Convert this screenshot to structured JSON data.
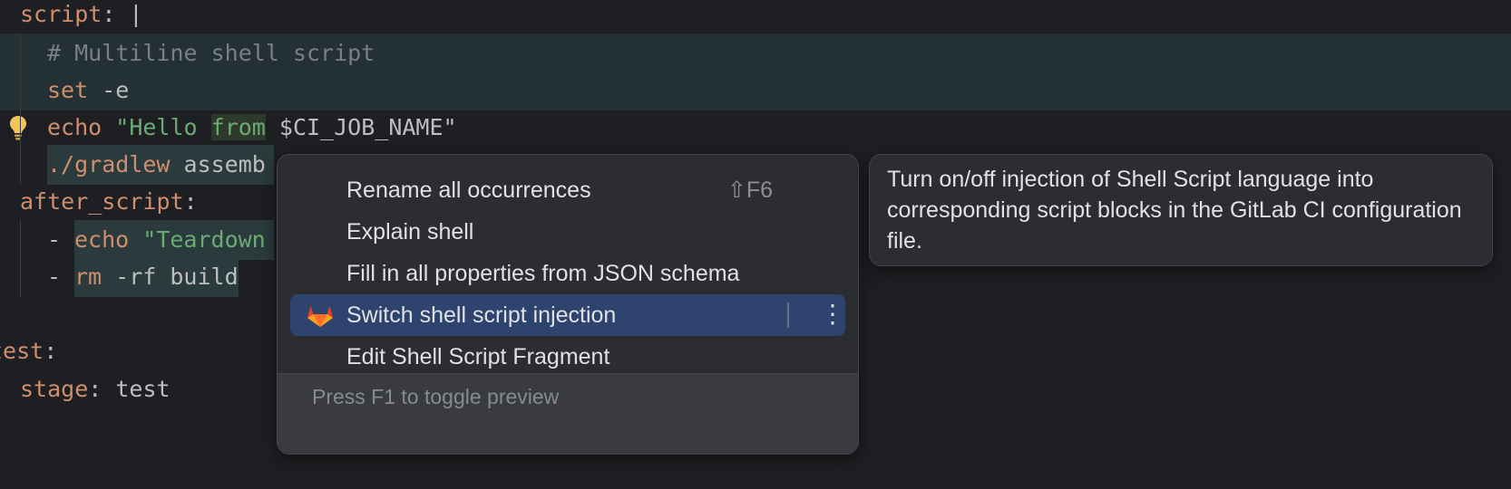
{
  "editor": {
    "line1": {
      "key": "script",
      "rest": ": |"
    },
    "line2": {
      "comment": "# Multiline shell script"
    },
    "line3": {
      "cmd": "set",
      "arg": " -e"
    },
    "line4": {
      "cmd": "echo",
      "str_a": " \"Hello ",
      "str_from": "from",
      "str_b": " $CI_JOB_NAME\""
    },
    "line5": {
      "cmd": "./gradlew",
      "arg": " assemb"
    },
    "line6": {
      "key": "after_script",
      "rest": ":"
    },
    "line7": {
      "dash": "- ",
      "cmd": "echo",
      "str": " \"Teardown"
    },
    "line8": {
      "dash": "- ",
      "cmd": "rm",
      "arg": " -rf build"
    },
    "line9": {
      "key": "test",
      "rest": ":"
    },
    "line10": {
      "key": "stage",
      "rest": ": test"
    }
  },
  "intention_popup": {
    "items": [
      {
        "label": "Rename all occurrences",
        "shortcut": "⇧F6"
      },
      {
        "label": "Explain shell"
      },
      {
        "label": "Fill in all properties from JSON schema"
      },
      {
        "label": "Switch shell script injection",
        "icon": "gitlab-icon"
      },
      {
        "label": "Edit Shell Script Fragment"
      }
    ],
    "footer": "Press F1 to toggle preview"
  },
  "tooltip": {
    "text": "Turn on/off injection of Shell Script language into corresponding script blocks in the GitLab CI configuration file."
  },
  "colors": {
    "background": "#1e1f22",
    "keyword": "#cf8e6d",
    "string": "#6aab73",
    "comment": "#7a7e85",
    "selected_item": "#2e436e"
  }
}
